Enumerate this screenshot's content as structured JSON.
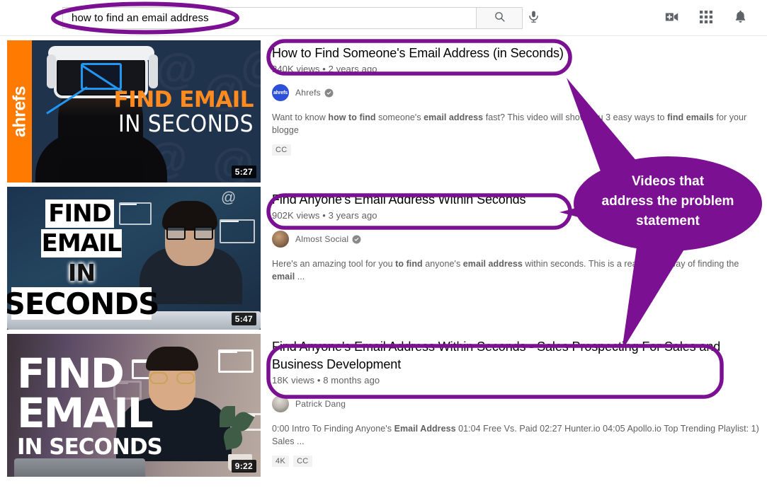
{
  "theme": {
    "annotation_purple": "#7B1192",
    "text_primary": "#030303",
    "text_secondary": "#606060",
    "page_bg": "#FFFFFF"
  },
  "header": {
    "search": {
      "value": "how to find an email address",
      "placeholder": "Search",
      "search_button_icon": "search-icon",
      "mic_button_icon": "microphone-icon"
    },
    "icons": [
      {
        "name": "create-video-icon",
        "label": "Create"
      },
      {
        "name": "apps-grid-icon",
        "label": "YouTube apps"
      },
      {
        "name": "notifications-bell-icon",
        "label": "Notifications"
      }
    ]
  },
  "results": [
    {
      "title": "How to Find Someone's Email Address (in Seconds)",
      "views": "240K views",
      "age": "2 years ago",
      "separator": "•",
      "channel": "Ahrefs",
      "verified": true,
      "avatar_text": "ahrefs",
      "avatar_color": "#2D50D8",
      "duration": "5:27",
      "description_parts": [
        {
          "t": "Want to know ",
          "b": false
        },
        {
          "t": "how to find",
          "b": true
        },
        {
          "t": " someone's ",
          "b": false
        },
        {
          "t": "email address",
          "b": true
        },
        {
          "t": " fast? This video will show you 3 easy ways to ",
          "b": false
        },
        {
          "t": "find emails",
          "b": true
        },
        {
          "t": " for your blogge",
          "b": false
        }
      ],
      "badges": [
        "CC"
      ],
      "thumbnail": {
        "brand": "ahrefs",
        "headline_line1": "FIND EMAIL",
        "headline_line2": "IN SECONDS"
      }
    },
    {
      "title": "Find Anyone's Email Address Within Seconds",
      "views": "902K views",
      "age": "3 years ago",
      "separator": "•",
      "channel": "Almost Social",
      "verified": true,
      "avatar_text": "",
      "avatar_color": "#8B7F6E",
      "duration": "5:47",
      "description_parts": [
        {
          "t": "Here's an amazing tool for you ",
          "b": false
        },
        {
          "t": "to find",
          "b": true
        },
        {
          "t": " anyone's ",
          "b": false
        },
        {
          "t": "email address",
          "b": true
        },
        {
          "t": " within seconds. This is a really easy way of finding the ",
          "b": false
        },
        {
          "t": "email",
          "b": true
        },
        {
          "t": " ...",
          "b": false
        }
      ],
      "badges": [],
      "thumbnail": {
        "headline_line1": "FIND",
        "headline_line2": "EMAIL",
        "headline_line3": "IN",
        "headline_line4": "SECONDS"
      }
    },
    {
      "title": "Find Anyone's Email Address Within Seconds - Sales Prospecting For Sales and Business Development",
      "views": "18K views",
      "age": "8 months ago",
      "separator": "•",
      "channel": "Patrick Dang",
      "verified": false,
      "avatar_text": "",
      "avatar_color": "#9aa0a6",
      "duration": "9:22",
      "description_parts": [
        {
          "t": "0:00 Intro To Finding Anyone's ",
          "b": false
        },
        {
          "t": "Email Address",
          "b": true
        },
        {
          "t": " 01:04 Free Vs. Paid 02:27 Hunter.io 04:05 Apollo.io Top Trending Playlist: 1) Sales ...",
          "b": false
        }
      ],
      "badges": [
        "4K",
        "CC"
      ],
      "thumbnail": {
        "headline_line1": "FIND",
        "headline_line2": "EMAIL",
        "headline_line3": "IN SECONDS"
      }
    }
  ],
  "annotations": {
    "callout_text_lines": [
      "Videos that",
      "address the problem",
      "statement"
    ],
    "callout_text": "Videos that address the problem statement",
    "highlighted_search_box": true,
    "highlighted_title_count": 3
  }
}
